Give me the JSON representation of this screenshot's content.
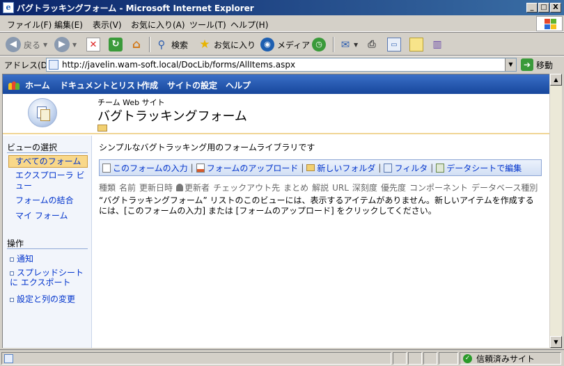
{
  "window": {
    "title": "バグトラッキングフォーム - Microsoft Internet Explorer",
    "minimize": "_",
    "maximize": "□",
    "close": "X"
  },
  "menu": [
    "ファイル(F)",
    "編集(E)",
    "表示(V)",
    "お気に入り(A)",
    "ツール(T)",
    "ヘルプ(H)"
  ],
  "toolbar": {
    "back": "戻る",
    "search": "検索",
    "favorites": "お気に入り",
    "media": "メディア"
  },
  "address": {
    "label": "アドレス(D)",
    "url": "http://javelin.wam-soft.local/DocLib/forms/AllItems.aspx",
    "go": "移動"
  },
  "topnav": [
    "ホーム",
    "ドキュメントとリスト",
    "作成",
    "サイトの設定",
    "ヘルプ"
  ],
  "header": {
    "site": "チーム Web サイト",
    "title": "バグトラッキングフォーム"
  },
  "leftnav": {
    "views_heading": "ビューの選択",
    "views": [
      "すべてのフォーム",
      "エクスプローラ ビュー",
      "フォームの結合",
      "マイ フォーム"
    ],
    "actions_heading": "操作",
    "actions": [
      "通知",
      "スプレッドシートに エクスポート",
      "設定と列の変更"
    ]
  },
  "main": {
    "description": "シンプルなバグトラッキング用のフォームライブラリです",
    "actionbar": [
      "このフォームの入力",
      "フォームのアップロード",
      "新しいフォルダ",
      "フィルタ",
      "データシートで編集"
    ],
    "columns": [
      "種類",
      "名前",
      "更新日時",
      "更新者",
      "チェックアウト先",
      "まとめ",
      "解説",
      "URL",
      "深刻度",
      "優先度",
      "コンポーネント",
      "データベース種別"
    ],
    "empty_message": "“バグトラッキングフォーム” リストのこのビューには、表示するアイテムがありません。新しいアイテムを作成するには、[このフォームの入力] または [フォームのアップロード] をクリックしてください。"
  },
  "status": {
    "zone": "信頼済みサイト"
  }
}
